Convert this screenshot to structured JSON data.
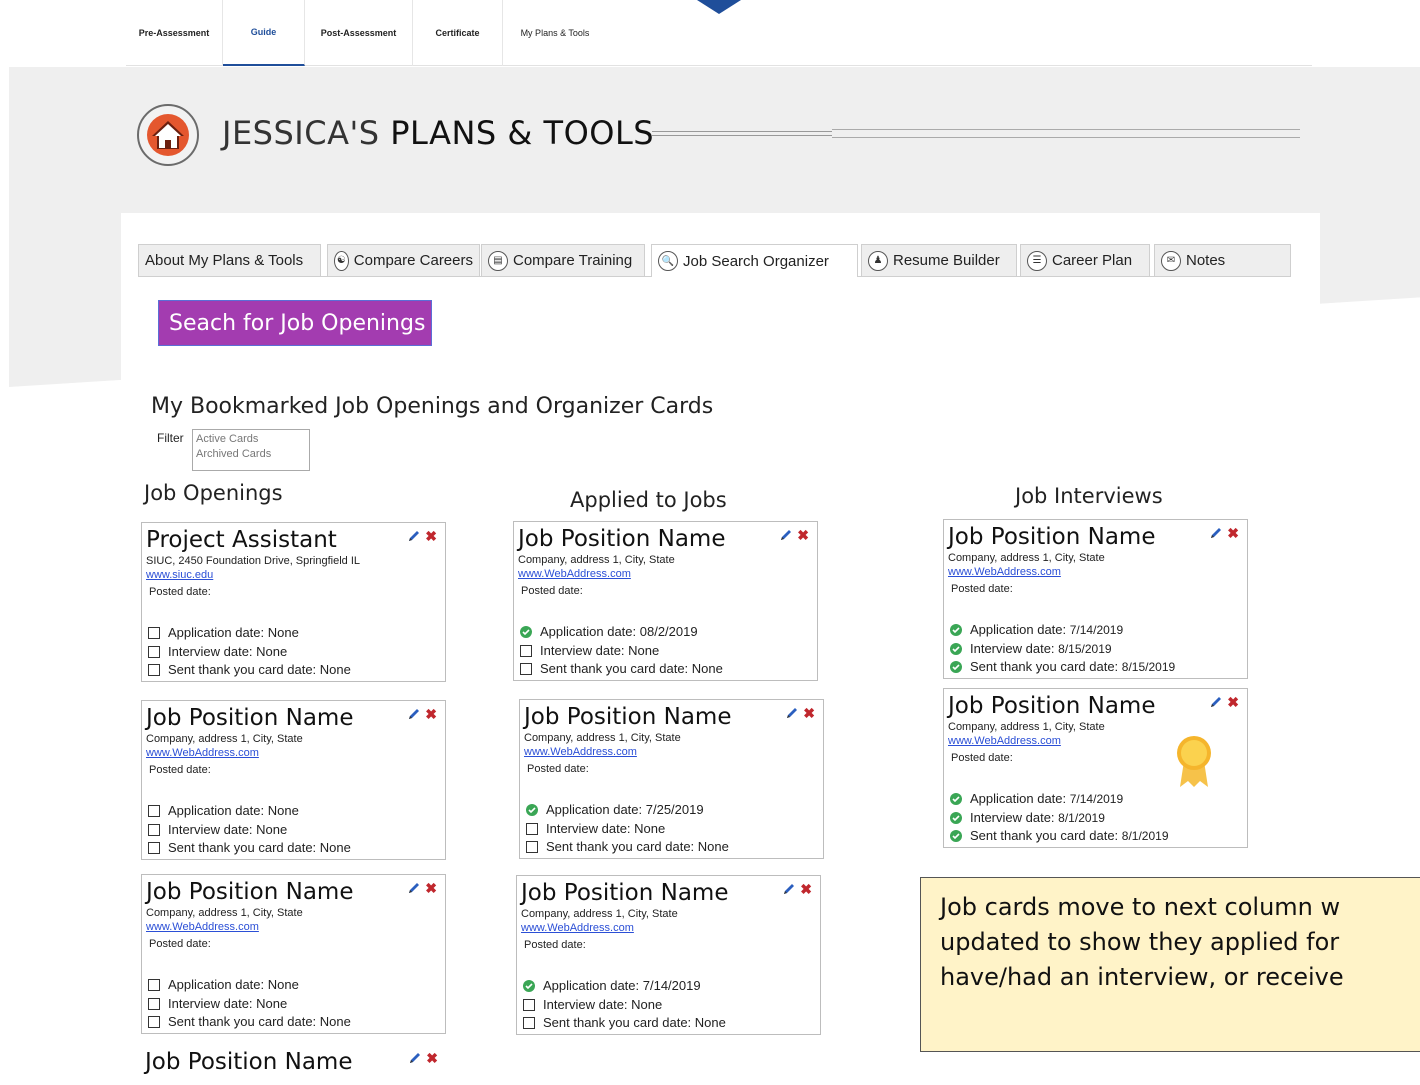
{
  "topnav": {
    "tabs": [
      {
        "label": "Pre-Assessment"
      },
      {
        "label": "Guide"
      },
      {
        "label": "Post-Assessment"
      },
      {
        "label": "Certificate"
      },
      {
        "label": "My Plans & Tools"
      }
    ],
    "active_tab": "Guide"
  },
  "header": {
    "title_prefix": "JESSICA'S",
    "title_main": "PLANS & TOOLS",
    "home_icon": "house-icon"
  },
  "tabs": [
    {
      "label": "About My Plans & Tools",
      "icon": ""
    },
    {
      "label": "Compare Careers",
      "icon": "compare-careers-icon"
    },
    {
      "label": "Compare Training",
      "icon": "compare-training-icon"
    },
    {
      "label": "Job Search Organizer",
      "icon": "job-search-icon"
    },
    {
      "label": "Resume Builder",
      "icon": "resume-icon"
    },
    {
      "label": "Career Plan",
      "icon": "career-plan-icon"
    },
    {
      "label": "Notes",
      "icon": "notes-icon"
    }
  ],
  "active_tab": "Job Search Organizer",
  "search_button": "Seach for Job Openings",
  "section_heading": "My Bookmarked Job Openings and Organizer Cards",
  "filter": {
    "label": "Filter",
    "options": [
      "Active Cards",
      "Archived Cards"
    ]
  },
  "columns": [
    {
      "title": "Job Openings",
      "cards": [
        {
          "title": "Project Assistant",
          "company": "SIUC, 2450 Foundation Drive, Springfield IL",
          "website": "www.siuc.edu",
          "posted_label": "Posted date:",
          "dates": [
            {
              "label": "Application date:",
              "value": "None",
              "status": "unchecked"
            },
            {
              "label": "Interview date:",
              "value": "None",
              "status": "unchecked"
            },
            {
              "label": "Sent thank you card date: ",
              "value": "None",
              "status": "unchecked"
            }
          ]
        },
        {
          "title": "Job Position Name",
          "company": "Company, address 1, City, State",
          "website": "www.WebAddress.com",
          "posted_label": "Posted date:",
          "dates": [
            {
              "label": "Application date:",
              "value": "None",
              "status": "unchecked"
            },
            {
              "label": "Interview date:",
              "value": "None",
              "status": "unchecked"
            },
            {
              "label": "Sent thank you card date: ",
              "value": "None",
              "status": "unchecked"
            }
          ]
        },
        {
          "title": "Job Position Name",
          "company": "Company, address 1, City, State",
          "website": "www.WebAddress.com",
          "posted_label": "Posted date:",
          "dates": [
            {
              "label": "Application date:",
              "value": "None",
              "status": "unchecked"
            },
            {
              "label": "Interview date:",
              "value": "None",
              "status": "unchecked"
            },
            {
              "label": "Sent thank you card date: ",
              "value": "None",
              "status": "unchecked"
            }
          ]
        },
        {
          "title": "Job Position Name"
        }
      ]
    },
    {
      "title": "Applied to Jobs",
      "cards": [
        {
          "title": "Job Position Name",
          "company": "Company, address 1, City, State",
          "website": "www.WebAddress.com",
          "posted_label": "Posted date:",
          "dates": [
            {
              "label": "Application date:",
              "value": "08/2/2019",
              "status": "done"
            },
            {
              "label": "Interview date:",
              "value": "None",
              "status": "unchecked"
            },
            {
              "label": "Sent thank you card date: ",
              "value": "None",
              "status": "unchecked"
            }
          ]
        },
        {
          "title": "Job Position Name",
          "company": "Company, address 1, City, State",
          "website": "www.WebAddress.com",
          "posted_label": "Posted date:",
          "dates": [
            {
              "label": "Application date:",
              "value": "7/25/2019",
              "status": "done"
            },
            {
              "label": "Interview date:",
              "value": "None",
              "status": "unchecked"
            },
            {
              "label": "Sent thank you card date: ",
              "value": "None",
              "status": "unchecked"
            }
          ]
        },
        {
          "title": "Job Position Name",
          "company": "Company, address 1, City, State",
          "website": "www.WebAddress.com",
          "posted_label": "Posted date:",
          "dates": [
            {
              "label": "Application date:",
              "value": "7/14/2019",
              "status": "done"
            },
            {
              "label": "Interview date:",
              "value": "None",
              "status": "unchecked"
            },
            {
              "label": "Sent thank you card date: ",
              "value": "None",
              "status": "unchecked"
            }
          ]
        }
      ]
    },
    {
      "title": "Job Interviews",
      "cards": [
        {
          "title": "Job Position Name",
          "company": "Company, address 1, City, State",
          "website": "www.WebAddress.com",
          "posted_label": "Posted date:",
          "dates": [
            {
              "label": "Application date:",
              "value": "7/14/2019",
              "status": "done"
            },
            {
              "label": "Interview date:",
              "value": "8/15/2019",
              "status": "done"
            },
            {
              "label": "Sent thank you card date:",
              "value": "8/15/2019",
              "status": "done"
            }
          ]
        },
        {
          "title": "Job Position Name",
          "company": "Company, address 1, City, State",
          "website": "www.WebAddress.com",
          "posted_label": "Posted date:",
          "badge": "award-ribbon-icon",
          "dates": [
            {
              "label": "Application date:",
              "value": "7/14/2019",
              "status": "done"
            },
            {
              "label": "Interview date:",
              "value": "8/1/2019",
              "status": "done"
            },
            {
              "label": "Sent thank you card date:",
              "value": "8/1/2019",
              "status": "done"
            }
          ]
        }
      ]
    }
  ],
  "callout": {
    "lines": [
      "Job cards move to next column w",
      "updated to show they applied for",
      "have/had an interview, or receive"
    ]
  },
  "colors": {
    "accent_blue": "#1f4e9a",
    "search_button": "#a33cb0",
    "delete_red": "#c0272d",
    "done_green": "#3aa655",
    "link_blue": "#2b4fd6",
    "callout_bg": "#fff3c8"
  }
}
